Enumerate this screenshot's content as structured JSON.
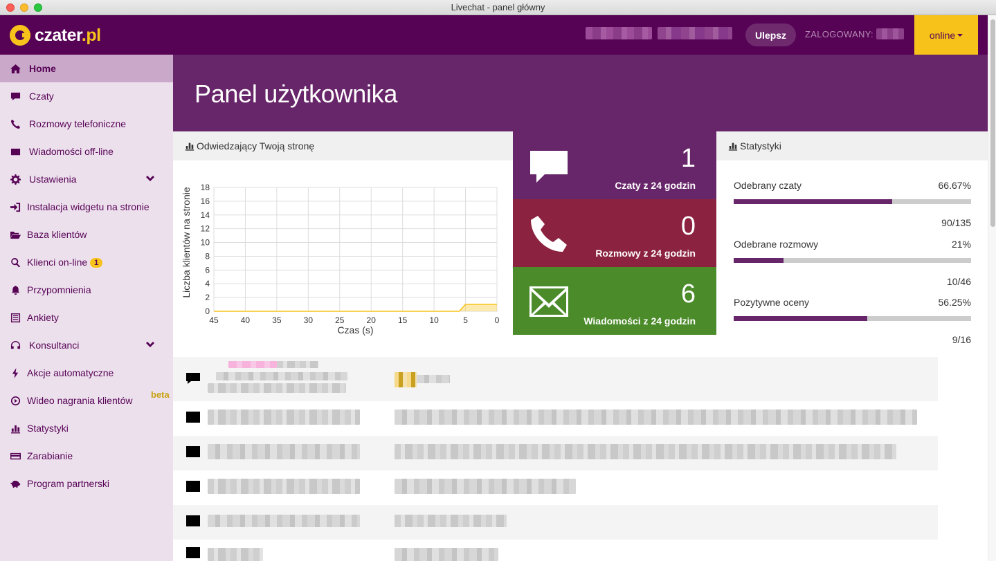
{
  "window": {
    "title": "Livechat - panel główny"
  },
  "header": {
    "logo_text": "czater",
    "logo_tld": ".pl",
    "upgrade_label": "Ulepsz",
    "logged_label": "ZALOGOWANY:",
    "status_label": "online"
  },
  "sidebar": {
    "items": [
      {
        "label": "Home",
        "icon": "home-icon",
        "active": true
      },
      {
        "label": "Czaty",
        "icon": "comment-icon"
      },
      {
        "label": "Rozmowy telefoniczne",
        "icon": "phone-icon"
      },
      {
        "label": "Wiadomości off-line",
        "icon": "envelope-icon"
      },
      {
        "label": "Ustawienia",
        "icon": "gear-icon",
        "expandable": true
      },
      {
        "label": "Instalacja widgetu na stronie",
        "icon": "sign-in-icon"
      },
      {
        "label": "Baza klientów",
        "icon": "folder-open-icon"
      },
      {
        "label": "Klienci on-line",
        "icon": "search-icon",
        "badge": "1"
      },
      {
        "label": "Przypomnienia",
        "icon": "bell-icon"
      },
      {
        "label": "Ankiety",
        "icon": "list-icon"
      },
      {
        "label": "Konsultanci",
        "icon": "headphones-icon",
        "expandable": true
      },
      {
        "label": "Akcje automatyczne",
        "icon": "bolt-icon"
      },
      {
        "label": "Wideo nagrania klientów",
        "icon": "play-circle-icon",
        "tag": "beta"
      },
      {
        "label": "Statystyki",
        "icon": "bar-chart-icon"
      },
      {
        "label": "Zarabianie",
        "icon": "credit-card-icon"
      },
      {
        "label": "Program partnerski",
        "icon": "piggy-bank-icon"
      }
    ]
  },
  "banner": {
    "title": "Panel użytkownika"
  },
  "visitors_panel": {
    "title": "Odwiedzający Twoją stronę"
  },
  "chart_data": {
    "type": "area",
    "xlabel": "Czas (s)",
    "ylabel": "Liczba klientów na stronie",
    "x_ticks": [
      45,
      40,
      35,
      30,
      25,
      20,
      15,
      10,
      5,
      0
    ],
    "y_ticks": [
      0,
      2,
      4,
      6,
      8,
      10,
      12,
      14,
      16,
      18
    ],
    "xlim": [
      45,
      0
    ],
    "ylim": [
      0,
      18
    ],
    "grid": true,
    "series": [
      {
        "color": "#f7c31b",
        "points": [
          [
            45,
            0
          ],
          [
            6,
            0
          ],
          [
            5,
            1
          ],
          [
            0,
            1
          ]
        ]
      }
    ]
  },
  "tiles": {
    "chats": {
      "number": "1",
      "label": "Czaty z 24 godzin",
      "color": "#68266a"
    },
    "calls": {
      "number": "0",
      "label": "Rozmowy z 24 godzin",
      "color": "#8b2340"
    },
    "mail": {
      "number": "6",
      "label": "Wiadomości z 24 godzin",
      "color": "#4b8b2a"
    }
  },
  "stats_panel": {
    "title": "Statystyki",
    "rows": [
      {
        "name": "Odebrany czaty",
        "percent": "66.67%",
        "fraction": 0.6667,
        "count": "90/135"
      },
      {
        "name": "Odebrane rozmowy",
        "percent": "21%",
        "fraction": 0.21,
        "count": "10/46"
      },
      {
        "name": "Pozytywne oceny",
        "percent": "56.25%",
        "fraction": 0.5625,
        "count": "9/16"
      }
    ]
  },
  "activity": {
    "rows": [
      {
        "icon": "comment-icon"
      },
      {
        "icon": "envelope-icon"
      },
      {
        "icon": "envelope-icon"
      },
      {
        "icon": "envelope-icon"
      },
      {
        "icon": "envelope-icon"
      },
      {
        "icon": "envelope-icon"
      }
    ]
  },
  "colors": {
    "brand": "#560355",
    "accent": "#f7c31b",
    "banner": "#68266a"
  }
}
